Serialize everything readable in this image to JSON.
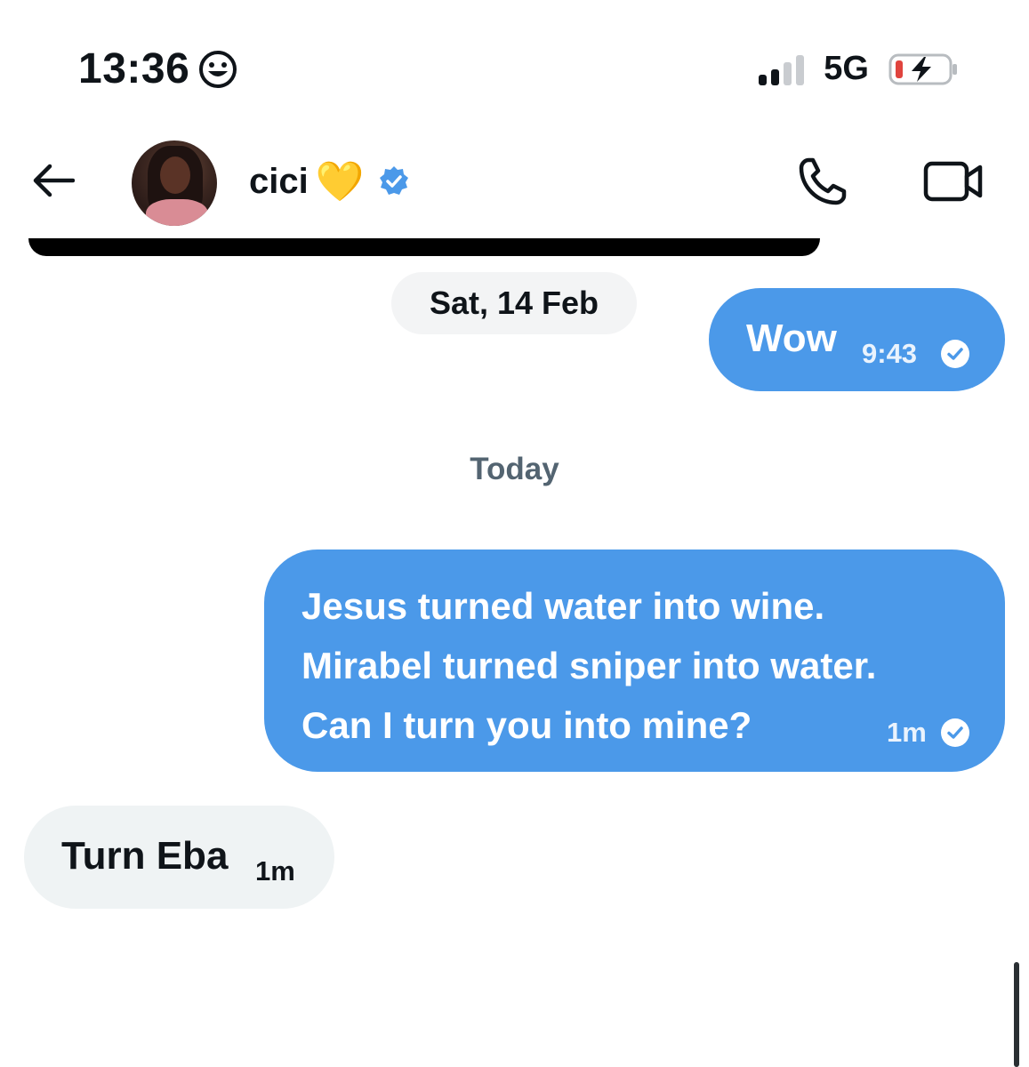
{
  "status_bar": {
    "time": "13:36",
    "status_emoji_icon": "smiley-face-icon",
    "network": "5G",
    "signal_bars_active": 2,
    "signal_bars_total": 4,
    "battery_level": 0.15,
    "battery_charging": true
  },
  "header": {
    "back_icon": "arrow-left-icon",
    "contact_name": "cici",
    "name_emoji": "💛",
    "verified": true,
    "call_icon": "phone-icon",
    "video_icon": "video-camera-icon"
  },
  "conversation": {
    "dates": {
      "first": "Sat, 14 Feb",
      "second": "Today"
    },
    "messages": [
      {
        "direction": "sent",
        "text": "Wow",
        "time": "9:43",
        "read": true
      },
      {
        "direction": "sent",
        "lines": [
          "Jesus turned water into wine.",
          "Mirabel turned sniper into water.",
          "Can I turn you into mine?"
        ],
        "time": "1m",
        "read": true
      },
      {
        "direction": "received",
        "text": "Turn Eba",
        "time": "1m"
      }
    ]
  },
  "colors": {
    "sent_bubble": "#4b99e9",
    "received_bubble": "#eff3f4",
    "verified_badge": "#4b99e9",
    "date_label_gray": "#536471"
  }
}
